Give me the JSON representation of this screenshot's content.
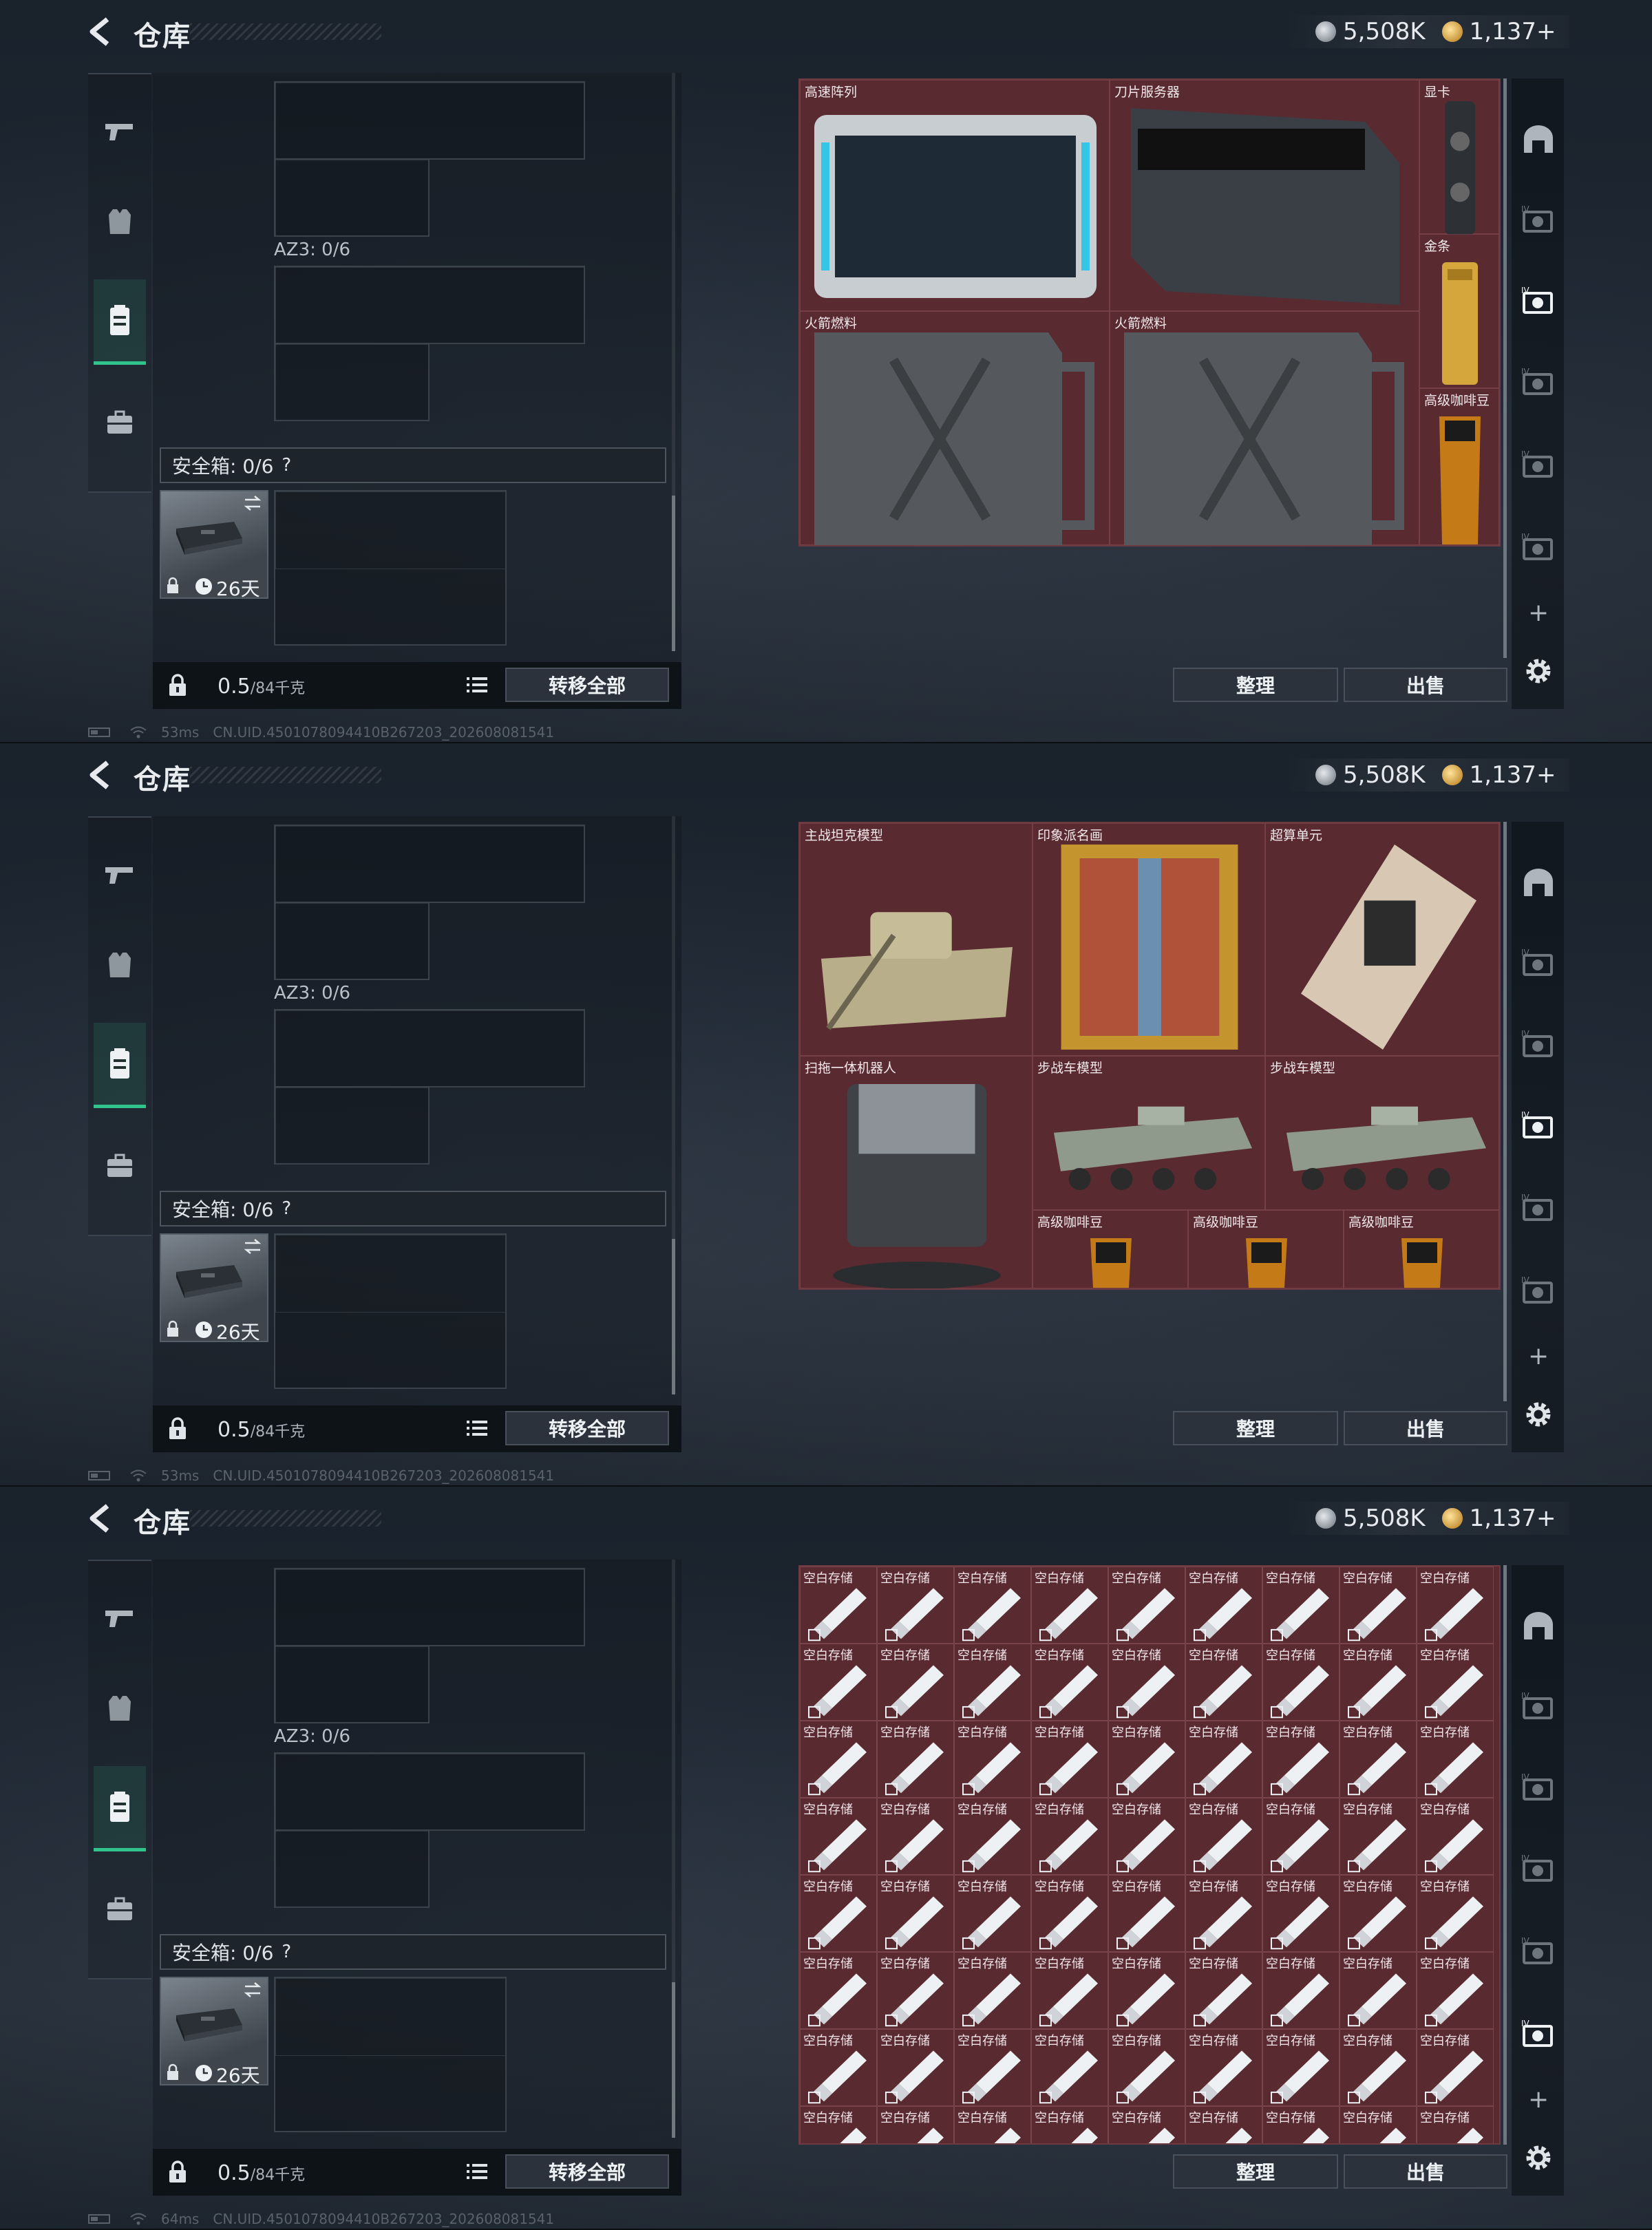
{
  "screens": [
    {
      "header": {
        "title": "仓库",
        "silver": "5,508K",
        "gold": "1,137+"
      },
      "storage": {
        "az_label": "AZ3: 0/6",
        "safe_label": "安全箱: 0/6",
        "help": "?",
        "case_days": "26天",
        "weight_value": "0.5",
        "weight_unit": "/84千克",
        "transfer_all": "转移全部"
      },
      "actions": {
        "sort": "整理",
        "sell": "出售"
      },
      "status": {
        "ping": "53ms",
        "uid": "CN.UID.4501078094410B267203_202608081541"
      },
      "items": [
        {
          "name": "高速阵列",
          "icon": "server-array-icon"
        },
        {
          "name": "刀片服务器",
          "icon": "blade-server-icon"
        },
        {
          "name": "显卡",
          "icon": "graphics-card-icon"
        },
        {
          "name": "金条",
          "icon": "gold-bar-icon"
        },
        {
          "name": "火箭燃料",
          "icon": "fuel-can-icon"
        },
        {
          "name": "火箭燃料",
          "icon": "fuel-can-icon"
        },
        {
          "name": "高级咖啡豆",
          "icon": "coffee-bag-icon"
        }
      ]
    },
    {
      "header": {
        "title": "仓库",
        "silver": "5,508K",
        "gold": "1,137+"
      },
      "storage": {
        "az_label": "AZ3: 0/6",
        "safe_label": "安全箱: 0/6",
        "help": "?",
        "case_days": "26天",
        "weight_value": "0.5",
        "weight_unit": "/84千克",
        "transfer_all": "转移全部"
      },
      "actions": {
        "sort": "整理",
        "sell": "出售"
      },
      "status": {
        "ping": "53ms",
        "uid": "CN.UID.4501078094410B267203_202608081541"
      },
      "items": [
        {
          "name": "主战坦克模型",
          "icon": "tank-model-icon"
        },
        {
          "name": "印象派名画",
          "icon": "framed-painting-icon"
        },
        {
          "name": "超算单元",
          "icon": "supercomputer-unit-icon"
        },
        {
          "name": "扫拖一体机器人",
          "icon": "cleaning-robot-icon"
        },
        {
          "name": "步战车模型",
          "icon": "ifv-model-icon"
        },
        {
          "name": "步战车模型",
          "icon": "ifv-model-icon"
        },
        {
          "name": "高级咖啡豆",
          "icon": "coffee-bag-icon"
        },
        {
          "name": "高级咖啡豆",
          "icon": "coffee-bag-icon"
        },
        {
          "name": "高级咖啡豆",
          "icon": "coffee-bag-icon"
        }
      ]
    },
    {
      "header": {
        "title": "仓库",
        "silver": "5,508K",
        "gold": "1,137+"
      },
      "storage": {
        "az_label": "AZ3: 0/6",
        "safe_label": "安全箱: 0/6",
        "help": "?",
        "case_days": "26天",
        "weight_value": "0.5",
        "weight_unit": "/84千克",
        "transfer_all": "转移全部"
      },
      "actions": {
        "sort": "整理",
        "sell": "出售"
      },
      "status": {
        "ping": "64ms",
        "uid": "CN.UID.4501078094410B267203_202608081541"
      },
      "blank_item_label": "空白存储"
    }
  ],
  "colors": {
    "container_bg": "#5a2a31",
    "active_tab": "#31c48d"
  }
}
